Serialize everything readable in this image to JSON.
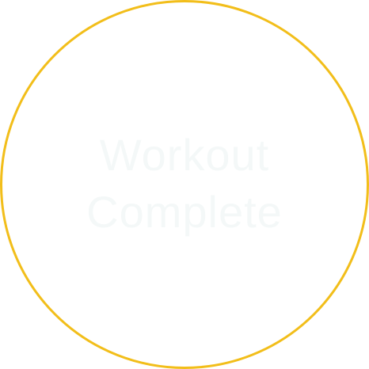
{
  "status": {
    "line1": "Workout",
    "line2": "Complete"
  },
  "colors": {
    "ring": "#F2BE1A",
    "text": "#F4F8F8",
    "background": "#FFFFFF"
  }
}
